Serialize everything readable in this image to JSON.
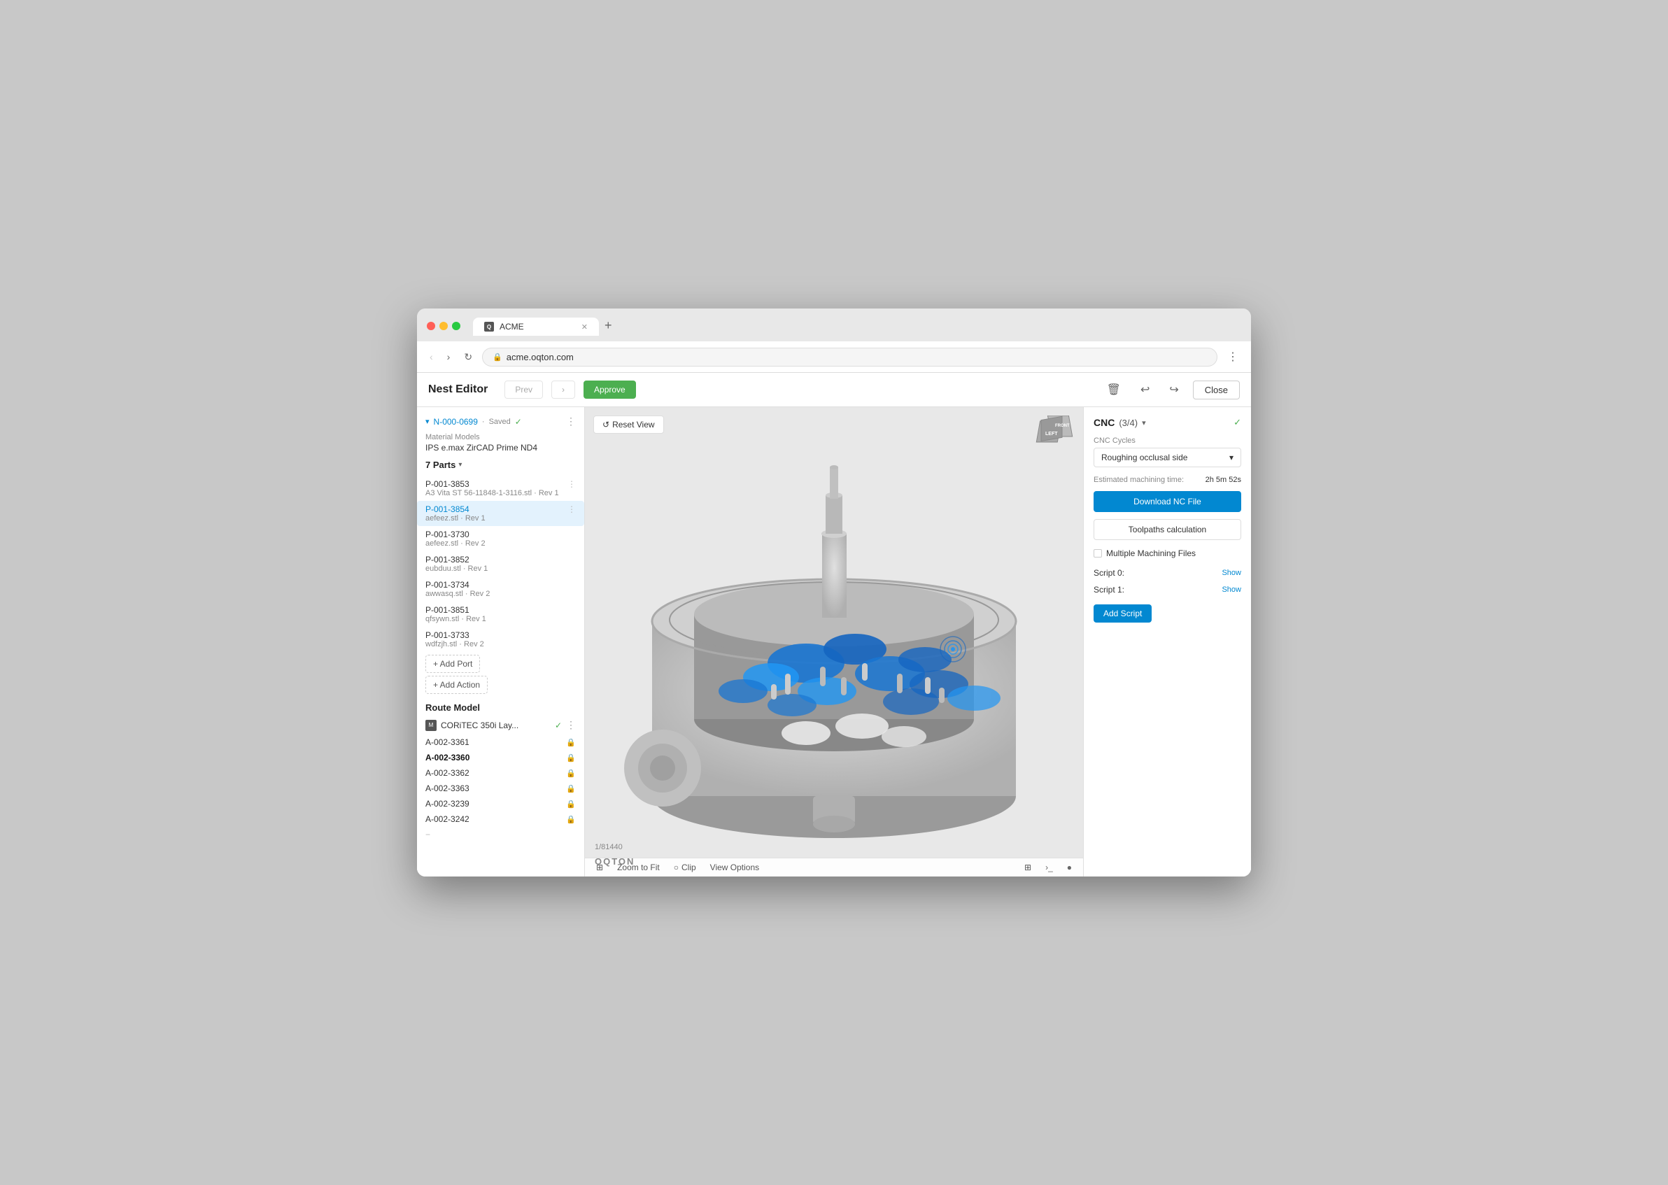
{
  "browser": {
    "url": "acme.oqton.com",
    "tab_title": "ACME",
    "new_tab_label": "+"
  },
  "header": {
    "title": "Nest Editor",
    "prev_label": "Prev",
    "next_label": "›",
    "approve_label": "Approve",
    "close_label": "Close"
  },
  "sidebar": {
    "nest_id": "N-000-0699",
    "saved_text": "Saved",
    "material_label": "Material Models",
    "material_value": "IPS e.max ZirCAD Prime ND4",
    "parts_header": "7 Parts",
    "parts": [
      {
        "id": "P-001-3853",
        "filename": "A3 Vita ST 56-11848-1-3116.stl · Rev 1",
        "selected": false
      },
      {
        "id": "P-001-3854",
        "filename": "aefeez.stl · Rev 1",
        "selected": true
      },
      {
        "id": "P-001-3730",
        "filename": "aefeez.stl · Rev 2",
        "selected": false
      },
      {
        "id": "P-001-3852",
        "filename": "eubduu.stl · Rev 1",
        "selected": false
      },
      {
        "id": "P-001-3734",
        "filename": "awwasq.stl · Rev 2",
        "selected": false
      },
      {
        "id": "P-001-3851",
        "filename": "qfsywn.stl · Rev 1",
        "selected": false
      },
      {
        "id": "P-001-3733",
        "filename": "wdfzjh.stl · Rev 2",
        "selected": false
      }
    ],
    "add_port_label": "+ Add Port",
    "add_action_label": "+ Add Action",
    "route_model_title": "Route Model",
    "machine_name": "CORiTEC 350i Lay...",
    "assemblies": [
      {
        "id": "A-002-3361",
        "bold": false
      },
      {
        "id": "A-002-3360",
        "bold": true
      },
      {
        "id": "A-002-3362",
        "bold": false
      },
      {
        "id": "A-002-3363",
        "bold": false
      },
      {
        "id": "A-002-3239",
        "bold": false
      },
      {
        "id": "A-002-3242",
        "bold": false
      }
    ]
  },
  "viewer": {
    "reset_view_label": "Reset View",
    "counter": "1/81440",
    "logo": "OQTON",
    "zoom_label": "Zoom to Fit",
    "clip_label": "Clip",
    "view_options_label": "View Options",
    "orientation": {
      "left": "LEFT",
      "front": "FRONT"
    }
  },
  "cnc_panel": {
    "title": "CNC",
    "count": "(3/4)",
    "cycles_label": "CNC Cycles",
    "cycle_value": "Roughing occlusal side",
    "estimated_label": "Estimated machining time:",
    "estimated_value": "2h 5m 52s",
    "download_label": "Download NC File",
    "toolpaths_label": "Toolpaths calculation",
    "multiple_files_label": "Multiple Machining Files",
    "script0_label": "Script 0:",
    "script0_show": "Show",
    "script1_label": "Script 1:",
    "script1_show": "Show",
    "add_script_label": "Add Script"
  }
}
